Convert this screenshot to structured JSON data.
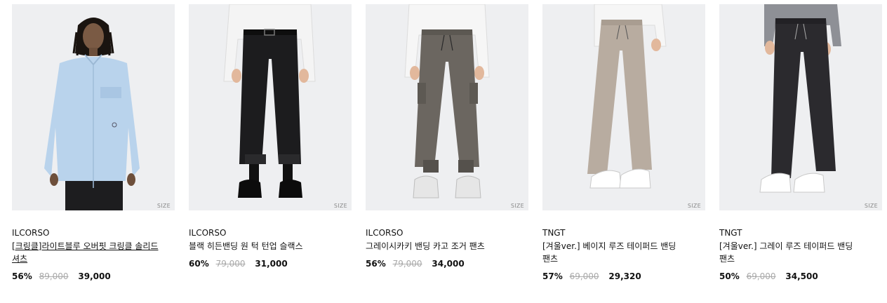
{
  "size_label": "SIZE",
  "products": [
    {
      "brand": "ILCORSO",
      "name": "[크링클]라이트블루 오버핏 크링클 솔리드 셔츠",
      "discount": "56%",
      "original_price": "89,000",
      "sale_price": "39,000",
      "image": "light-blue-shirt"
    },
    {
      "brand": "ILCORSO",
      "name": "블랙 히든밴딩 원 턱 턴업 슬랙스",
      "discount": "60%",
      "original_price": "79,000",
      "sale_price": "31,000",
      "image": "black-slacks"
    },
    {
      "brand": "ILCORSO",
      "name": "그레이시카키 밴딩 카고 조거 팬츠",
      "discount": "56%",
      "original_price": "79,000",
      "sale_price": "34,000",
      "image": "khaki-cargo-jogger"
    },
    {
      "brand": "TNGT",
      "name": "[겨울ver.] 베이지 루즈 테이퍼드 밴딩 팬츠",
      "discount": "57%",
      "original_price": "69,000",
      "sale_price": "29,320",
      "image": "beige-tapered-pants"
    },
    {
      "brand": "TNGT",
      "name": "[겨울ver.] 그레이 루즈 테이퍼드 밴딩 팬츠",
      "discount": "50%",
      "original_price": "69,000",
      "sale_price": "34,500",
      "image": "grey-tapered-pants"
    }
  ]
}
